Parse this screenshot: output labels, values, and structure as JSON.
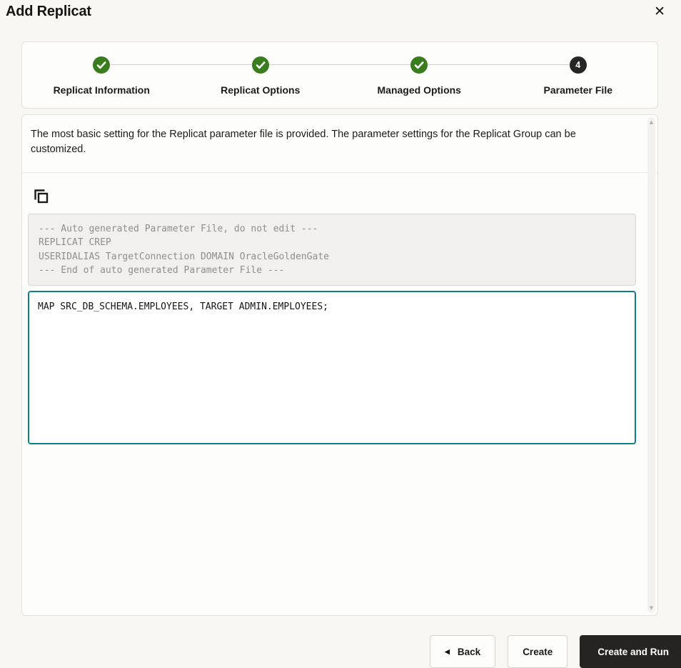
{
  "dialog": {
    "title": "Add Replicat"
  },
  "icons": {
    "close": "✕",
    "back_arrow": "◀",
    "scroll_up": "▲",
    "scroll_down": "▼"
  },
  "stepper": {
    "steps": [
      {
        "label": "Replicat Information",
        "state": "complete"
      },
      {
        "label": "Replicat Options",
        "state": "complete"
      },
      {
        "label": "Managed Options",
        "state": "complete"
      },
      {
        "label": "Parameter File",
        "state": "current",
        "number": "4"
      }
    ]
  },
  "content": {
    "description": "The most basic setting for the Replicat parameter file is provided. The parameter settings for the Replicat Group can be customized.",
    "auto_generated_parameters": "--- Auto generated Parameter File, do not edit ---\nREPLICAT CREP\nUSERIDALIAS TargetConnection DOMAIN OracleGoldenGate\n--- End of auto generated Parameter File ---",
    "parameter_editor_value": "MAP SRC_DB_SCHEMA.EMPLOYEES, TARGET ADMIN.EMPLOYEES;"
  },
  "footer": {
    "back_label": "Back",
    "create_label": "Create",
    "create_and_run_label": "Create and Run"
  },
  "colors": {
    "success_green": "#3a7d1e",
    "current_step_black": "#262626",
    "editor_focus_teal": "#107e8c",
    "primary_button_bg": "#262422",
    "page_background": "#f8f7f4"
  }
}
